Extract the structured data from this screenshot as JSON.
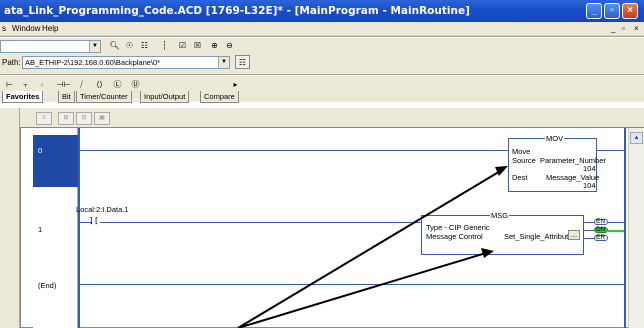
{
  "titlebar": {
    "title": "ata_Link_Programming_Code.ACD [1769-L32E]* - [MainProgram - MainRoutine]",
    "minimize": "_",
    "maximize": "▫",
    "close": "×"
  },
  "menubar": {
    "items": [
      "s",
      "Window",
      "Help"
    ],
    "mdi_min": "_",
    "mdi_restore": "▫",
    "mdi_close": "×"
  },
  "toolbar": {
    "path_label": "Path:",
    "path_value": "AB_ETHIP-2\\192.168.0.60\\Backplane\\0*",
    "dropdown_arrow": "▼"
  },
  "tabs": [
    {
      "label": "Favorites"
    },
    {
      "label": "Bit"
    },
    {
      "label": "Timer/Counter"
    },
    {
      "label": "Input/Output"
    },
    {
      "label": "Compare"
    }
  ],
  "ladder": {
    "rungs": [
      {
        "number": "0"
      },
      {
        "number": "1"
      },
      {
        "number": "(End)"
      }
    ],
    "contact": {
      "tag": "Local:2:I.Data.1",
      "symbol": "]["
    },
    "mov": {
      "mnemonic": "MOV",
      "title": "Move",
      "source_label": "Source",
      "source_tag": "Parameter_Number",
      "source_value": "104",
      "dest_label": "Dest",
      "dest_tag": "Message_Value",
      "dest_value": "104"
    },
    "msg": {
      "mnemonic": "MSG",
      "type_label": "Type - CIP Generic",
      "control_label": "Message Control",
      "control_tag": "Set_Single_Attribute",
      "browse": "...",
      "outputs": [
        "EN",
        "DN",
        "ER"
      ]
    }
  },
  "colors": {
    "accent": "#1f4aa3",
    "wire": "#3b5bad",
    "done_bit": "#3bbf3b"
  }
}
